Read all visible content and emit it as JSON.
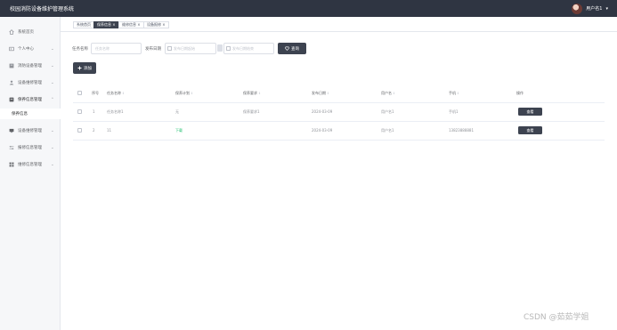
{
  "header": {
    "app_title": "校园消防设备维护管理系统",
    "user_name": "用户名1",
    "caret": "▾"
  },
  "sidebar": {
    "items": [
      {
        "label": "系统首页",
        "icon": "home-icon",
        "chevron": ""
      },
      {
        "label": "个人中心",
        "icon": "user-card-icon",
        "chevron": "⌄"
      },
      {
        "label": "消防设备管理",
        "icon": "equipment-icon",
        "chevron": "⌄"
      },
      {
        "label": "设备维修管理",
        "icon": "person-icon",
        "chevron": "⌄"
      },
      {
        "label": "保养信息管理",
        "icon": "maintenance-icon",
        "chevron": "⌃"
      },
      {
        "label": "保养信息",
        "icon": "",
        "chevron": ""
      },
      {
        "label": "设备维修管理",
        "icon": "monitor-icon",
        "chevron": "⌄"
      },
      {
        "label": "报修信息管理",
        "icon": "sliders-icon",
        "chevron": "⌄"
      },
      {
        "label": "维修信息管理",
        "icon": "grid-icon",
        "chevron": "⌄"
      }
    ]
  },
  "tabs": [
    {
      "label": "系统首页"
    },
    {
      "label": "保养信息 ×"
    },
    {
      "label": "维修信息 ×"
    },
    {
      "label": "设备报修 ×"
    }
  ],
  "search": {
    "task_label": "任务名称",
    "task_placeholder": "任务名称",
    "date_label": "发布日期",
    "date_start_placeholder": "发布日期起始",
    "date_end_placeholder": "发布日期结束",
    "search_button": "查询",
    "search_icon": "heart-icon"
  },
  "toolbar": {
    "add_button": "添加",
    "add_icon": "plus-icon"
  },
  "table": {
    "sort_glyph": "⇕",
    "columns": [
      "序号",
      "任务名称",
      "保养计划",
      "保养要求",
      "发布日期",
      "用户名",
      "手机",
      "操作"
    ],
    "rows": [
      {
        "index": "1",
        "task_name": "任务名称1",
        "plan": "无",
        "requirement": "保养要求1",
        "date": "2024-03-09",
        "user": "用户名1",
        "phone": "手机1",
        "action": "查看"
      },
      {
        "index": "2",
        "task_name": "11",
        "plan": "下载",
        "requirement": "",
        "date": "2024-03-09",
        "user": "用户名1",
        "phone": "13823888881",
        "action": "查看"
      }
    ]
  },
  "watermark": "CSDN @茹茹学姐",
  "colors": {
    "topbar": "#2f3542",
    "accent_dark": "#3d4350",
    "link_green": "#19be6b",
    "sidebar_bg": "#f6f7f9"
  }
}
